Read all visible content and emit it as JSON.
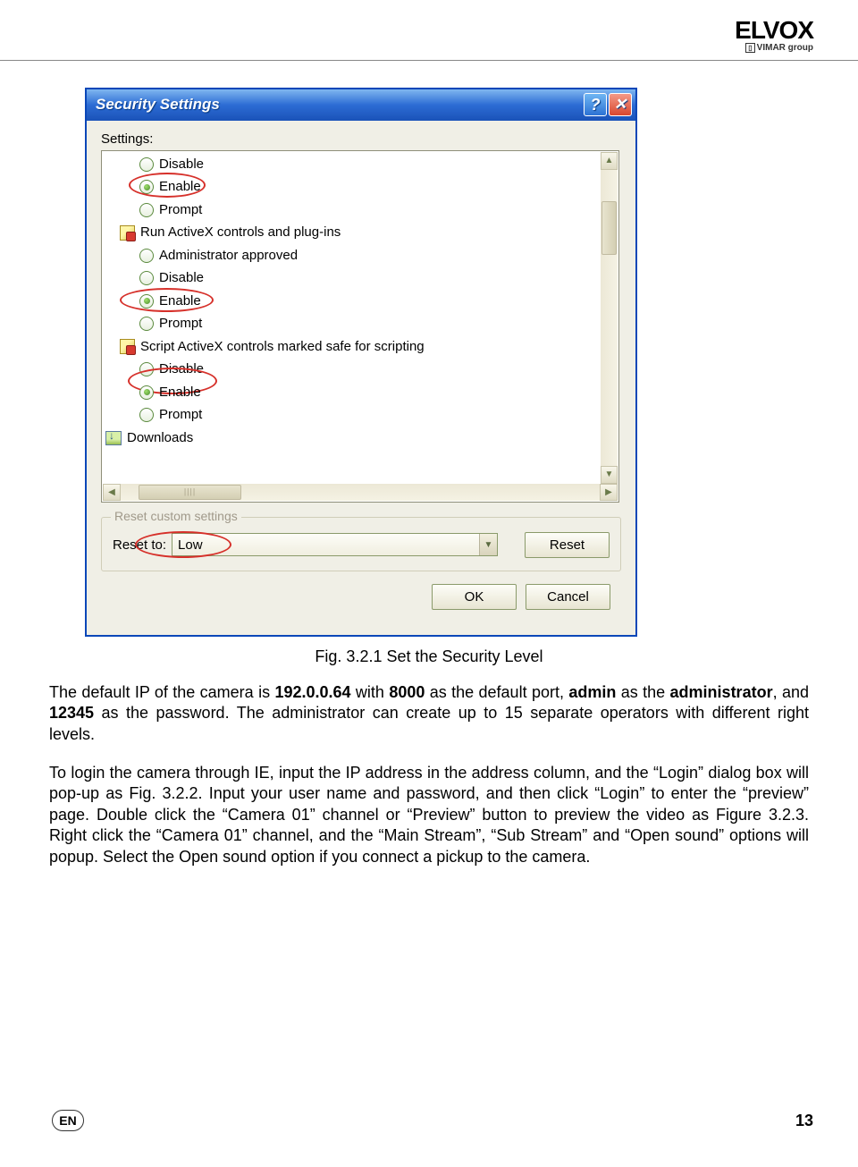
{
  "header": {
    "logo_main": "ELVOX",
    "logo_sub_prefix": "▯",
    "logo_sub": "VIMAR group"
  },
  "dialog": {
    "title": "Security Settings",
    "settings_label": "Settings:",
    "items": [
      {
        "type": "radio",
        "label": "Disable",
        "checked": false,
        "circled": false
      },
      {
        "type": "radio",
        "label": "Enable",
        "checked": true,
        "circled": true
      },
      {
        "type": "radio",
        "label": "Prompt",
        "checked": false,
        "circled": false
      },
      {
        "type": "category",
        "icon": "activex",
        "label": "Run ActiveX controls and plug-ins"
      },
      {
        "type": "radio",
        "label": "Administrator approved",
        "checked": false,
        "circled": false
      },
      {
        "type": "radio",
        "label": "Disable",
        "checked": false,
        "circled": false
      },
      {
        "type": "radio",
        "label": "Enable",
        "checked": true,
        "circled": true
      },
      {
        "type": "radio",
        "label": "Prompt",
        "checked": false,
        "circled": false
      },
      {
        "type": "category",
        "icon": "activex",
        "label": "Script ActiveX controls marked safe for scripting"
      },
      {
        "type": "radio",
        "label": "Disable",
        "checked": false,
        "circled": false
      },
      {
        "type": "radio",
        "label": "Enable",
        "checked": true,
        "circled": true
      },
      {
        "type": "radio",
        "label": "Prompt",
        "checked": false,
        "circled": false
      },
      {
        "type": "category_top",
        "icon": "downloads",
        "label": "Downloads"
      }
    ],
    "fieldset": {
      "legend": "Reset custom settings",
      "reset_to_label": "Reset to:",
      "combo_value": "Low",
      "reset_button": "Reset"
    },
    "ok_button": "OK",
    "cancel_button": "Cancel"
  },
  "caption": "Fig. 3.2.1 Set the Security Level",
  "paragraphs": {
    "p1_a": "The default IP of the camera is ",
    "p1_b": "192.0.0.64",
    "p1_c": " with ",
    "p1_d": "8000",
    "p1_e": " as the default port, ",
    "p1_f": "admin",
    "p1_g": " as the ",
    "p1_h": "administrator",
    "p1_i": ", and ",
    "p1_j": "12345",
    "p1_k": " as the password. The administrator can create up to 15 separate operators with different right levels.",
    "p2": "To login the camera through IE, input the IP address in the address column, and the “Login” dialog box will pop-up as Fig. 3.2.2. Input your user name and password, and then click “Login” to enter the “preview” page. Double click the “Camera 01” channel or “Preview” button to preview the video as Figure 3.2.3. Right click the “Camera 01” channel, and the “Main Stream”, “Sub Stream” and “Open sound” options will popup. Select the Open sound option if you connect a pickup to the camera."
  },
  "footer": {
    "lang": "EN",
    "page": "13"
  }
}
